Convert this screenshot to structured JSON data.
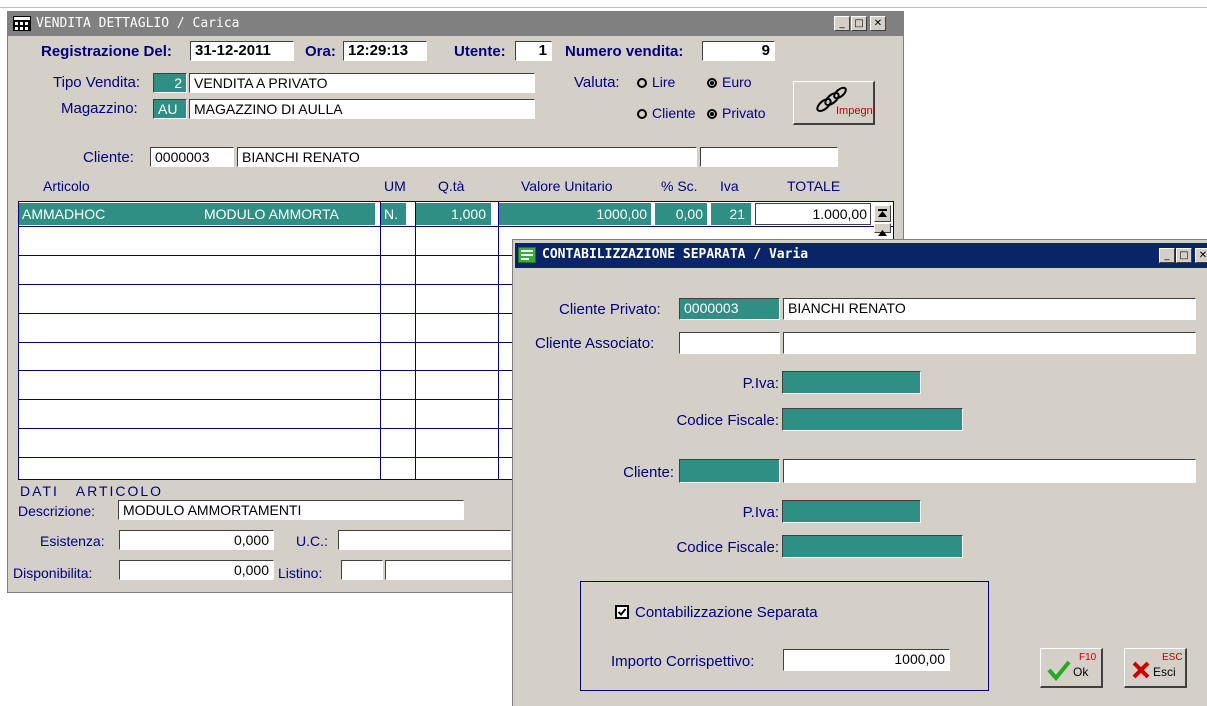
{
  "main_window": {
    "title": "VENDITA DETTAGLIO / Carica",
    "registrazione_label": "Registrazione Del:",
    "registrazione_value": "31-12-2011",
    "ora_label": "Ora:",
    "ora_value": "12:29:13",
    "utente_label": "Utente:",
    "utente_value": "1",
    "numero_label": "Numero vendita:",
    "numero_value": "9",
    "tipo_label": "Tipo Vendita:",
    "tipo_code": "2",
    "tipo_desc": "VENDITA A PRIVATO",
    "magazzino_label": "Magazzino:",
    "magazzino_code": "AU",
    "magazzino_desc": "MAGAZZINO DI AULLA",
    "valuta_label": "Valuta:",
    "radio_lire": "Lire",
    "radio_euro": "Euro",
    "radio_cliente": "Cliente",
    "radio_privato": "Privato",
    "impegni_label": "Impegni",
    "cliente_label": "Cliente:",
    "cliente_code": "0000003",
    "cliente_name": "BIANCHI RENATO",
    "cliente_extra": "",
    "columns": {
      "articolo": "Articolo",
      "um": "UM",
      "qta": "Q.tà",
      "valore": "Valore Unitario",
      "sconto": "% Sc.",
      "iva": "Iva",
      "totale": "TOTALE"
    },
    "row": {
      "articolo": "AMMADHOC",
      "descr": "MODULO AMMORTA",
      "um": "N.",
      "qta": "1,000",
      "valore": "1000,00",
      "sconto": "0,00",
      "iva": "21",
      "totale": "1.000,00"
    },
    "dati_articolo": "DATI   ARTICOLO",
    "descrizione_label": "Descrizione:",
    "descrizione_value": "MODULO AMMORTAMENTI",
    "esistenza_label": "Esistenza:",
    "esistenza_value": "0,000",
    "uc_label": "U.C.:",
    "disponibilita_label": "Disponibilita:",
    "disponibilita_value": "0,000",
    "listino_label": "Listino:"
  },
  "dialog": {
    "title": "CONTABILIZZAZIONE SEPARATA / Varia",
    "cliente_privato_label": "Cliente Privato:",
    "cliente_privato_code": "0000003",
    "cliente_privato_name": "BIANCHI RENATO",
    "cliente_associato_label": "Cliente Associato:",
    "piva_label_1": "P.Iva:",
    "cf_label_1": "Codice Fiscale:",
    "cliente_label": "Cliente:",
    "piva_label_2": "P.Iva:",
    "cf_label_2": "Codice Fiscale:",
    "contab_label": "Contabilizzazione Separata",
    "importo_label": "Importo Corrispettivo:",
    "importo_value": "1000,00",
    "ok_key": "F10",
    "ok_label": "Ok",
    "esci_key": "ESC",
    "esci_label": "Esci"
  },
  "colors": {
    "teal": "#2f8f85",
    "navy": "#000080",
    "titlebar_active": "#0a246a",
    "titlebar_inactive": "#808080",
    "face": "#d4d0c8"
  }
}
